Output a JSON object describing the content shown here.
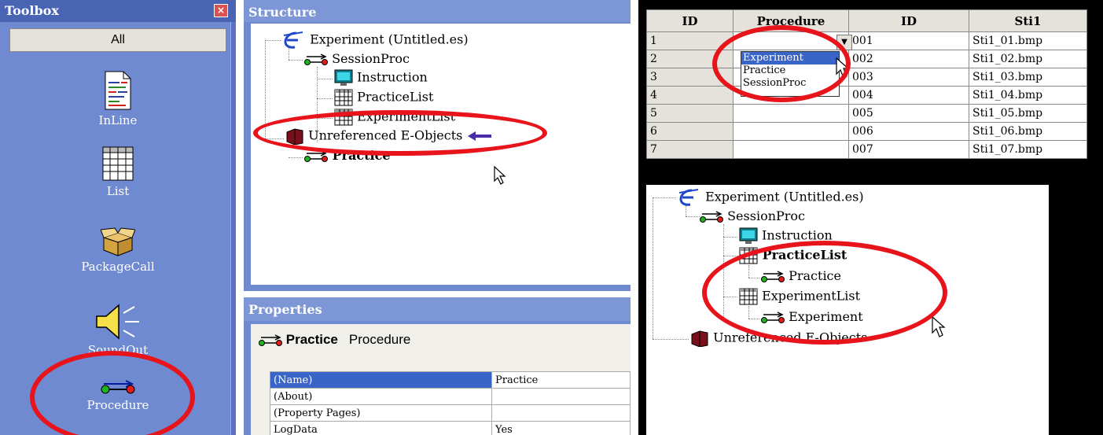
{
  "toolbox": {
    "title": "Toolbox",
    "close": "×",
    "all_label": "All",
    "items": [
      {
        "label": "InLine",
        "icon": "inline-script-icon"
      },
      {
        "label": "List",
        "icon": "list-grid-icon"
      },
      {
        "label": "PackageCall",
        "icon": "package-box-icon"
      },
      {
        "label": "SoundOut",
        "icon": "speaker-icon"
      },
      {
        "label": "Procedure",
        "icon": "procedure-arrow-icon"
      }
    ]
  },
  "structure": {
    "title": "Structure",
    "tree": [
      {
        "label": "Experiment (Untitled.es)",
        "icon": "experiment-e-icon",
        "bold": false
      },
      {
        "label": "SessionProc",
        "icon": "procedure-arrow-icon",
        "bold": false
      },
      {
        "label": "Instruction",
        "icon": "textdisplay-icon",
        "bold": false
      },
      {
        "label": "PracticeList",
        "icon": "list-grid-icon",
        "bold": false
      },
      {
        "label": "ExperimentList",
        "icon": "list-grid-icon",
        "bold": false
      },
      {
        "label": "Unreferenced E-Objects",
        "icon": "book-icon",
        "bold": false
      },
      {
        "label": "Practice",
        "icon": "procedure-arrow-icon",
        "bold": true
      }
    ]
  },
  "properties": {
    "title": "Properties",
    "object_name": "Practice",
    "object_type": "Procedure",
    "rows": [
      {
        "name": "(Name)",
        "value": "Practice"
      },
      {
        "name": "(About)",
        "value": ""
      },
      {
        "name": "(Property Pages)",
        "value": ""
      },
      {
        "name": "LogData",
        "value": "Yes"
      }
    ]
  },
  "grid": {
    "headers": [
      "ID",
      "Procedure",
      "ID",
      "Sti1"
    ],
    "rows": [
      {
        "id": "1",
        "proc": "",
        "id2": "001",
        "sti": "Sti1_01.bmp"
      },
      {
        "id": "2",
        "proc": "",
        "id2": "002",
        "sti": "Sti1_02.bmp"
      },
      {
        "id": "3",
        "proc": "",
        "id2": "003",
        "sti": "Sti1_03.bmp"
      },
      {
        "id": "4",
        "proc": "",
        "id2": "004",
        "sti": "Sti1_04.bmp"
      },
      {
        "id": "5",
        "proc": "",
        "id2": "005",
        "sti": "Sti1_05.bmp"
      },
      {
        "id": "6",
        "proc": "",
        "id2": "006",
        "sti": "Sti1_06.bmp"
      },
      {
        "id": "7",
        "proc": "",
        "id2": "007",
        "sti": "Sti1_07.bmp"
      }
    ],
    "dropdown_options": [
      "Experiment",
      "Practice",
      "SessionProc"
    ],
    "dropdown_selected": "Experiment"
  },
  "tree2": [
    {
      "label": "Experiment (Untitled.es)",
      "icon": "experiment-e-icon",
      "bold": false
    },
    {
      "label": "SessionProc",
      "icon": "procedure-arrow-icon",
      "bold": false
    },
    {
      "label": "Instruction",
      "icon": "textdisplay-icon",
      "bold": false
    },
    {
      "label": "PracticeList",
      "icon": "list-grid-icon",
      "bold": true
    },
    {
      "label": "Practice",
      "icon": "procedure-arrow-icon",
      "bold": false
    },
    {
      "label": "ExperimentList",
      "icon": "list-grid-icon",
      "bold": false
    },
    {
      "label": "Experiment",
      "icon": "procedure-arrow-icon",
      "bold": false
    },
    {
      "label": "Unreferenced E-Objects",
      "icon": "book-icon",
      "bold": false
    }
  ],
  "colors": {
    "highlight": "#e8141b",
    "panel": "#6f8ad0",
    "selection": "#3a65c8"
  }
}
